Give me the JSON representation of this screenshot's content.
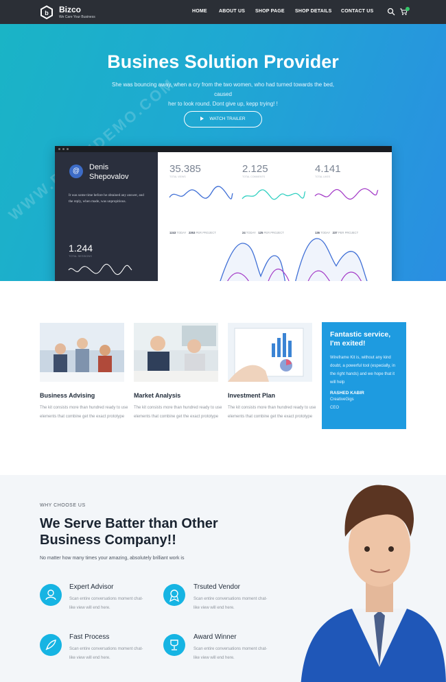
{
  "brand": {
    "name": "Bizco",
    "tagline": "We Care Your Business"
  },
  "nav": {
    "items": [
      "HOME",
      "ABOUT US",
      "SHOP PAGE",
      "SHOP DETAILS",
      "CONTACT US"
    ]
  },
  "hero": {
    "title": "Busines Solution Provider",
    "subtitle_line1": "She was bouncing away, when a cry from the two women, who had turned towards the bed, caused",
    "subtitle_line2": "her to look round. Dont give up, kepp trying! !",
    "button": "WATCH TRAILER"
  },
  "dashboard": {
    "profile_first": "Denis",
    "profile_last": "Shepovalov",
    "quote": "It was some time before he obtained any answer, and the reply, when made, was unpropitious.",
    "side_value": "1.244",
    "side_label": "TOTAL SESSIONS",
    "stats": [
      {
        "value": "35.385",
        "label": "TOTAL VIEWS",
        "today": "1243",
        "today_label": "TODAY",
        "proj": "2353",
        "proj_label": "PER PROJECT",
        "color": "#3f6fd6"
      },
      {
        "value": "2.125",
        "label": "TOTAL COMMENTS",
        "today": "24",
        "today_label": "TODAY",
        "proj": "125",
        "proj_label": "PER PROJECT",
        "color": "#2ecfc0"
      },
      {
        "value": "4.141",
        "label": "TOTAL LIKES",
        "today": "136",
        "today_label": "TODAY",
        "proj": "237",
        "proj_label": "PER PROJECT",
        "color": "#a33ac7"
      }
    ]
  },
  "services": [
    {
      "title": "Business Advising",
      "text": "The kit consists more than hundred ready to use elements that combine get the exact prototype"
    },
    {
      "title": "Market Analysis",
      "text": "The kit consists more than hundred ready to use elements that combine get the exact prototype"
    },
    {
      "title": "Investment Plan",
      "text": "The kit consists more than hundred ready to use elements that combine get the exact prototype"
    }
  ],
  "testimonial": {
    "title": "Fantastic service, I'm exited!",
    "text": "Wireframe Kit is, without any kind doubt, a powerful tool (especially, in the right hands) and we hope that it will help",
    "name": "RASHED KABIR",
    "company": "CreativeGigs",
    "role": "CEO"
  },
  "why": {
    "eyebrow": "WHY CHOOSE US",
    "title": "We Serve Batter than Other Business Company!!",
    "subtitle": "No matter how many times your amazing, absolutely brilliant work is",
    "features": [
      {
        "title": "Expert Advisor",
        "text": "Scan entire conversations moment chat-like view will end here.",
        "icon": "user-icon"
      },
      {
        "title": "Trsuted Vendor",
        "text": "Scan entire conversations moment chat-like view will end here.",
        "icon": "badge-icon"
      },
      {
        "title": "Fast Process",
        "text": "Scan entire conversations moment chat-like view will end here.",
        "icon": "rocket-icon"
      },
      {
        "title": "Award Winner",
        "text": "Scan entire conversations moment chat-like view will end here.",
        "icon": "trophy-icon"
      }
    ]
  },
  "watermark": "WWW.DOWNDEMO.COM",
  "colors": {
    "accent": "#16b4e3",
    "nav_bg": "#2b2f36",
    "testimonial_bg": "#1e9be0"
  }
}
